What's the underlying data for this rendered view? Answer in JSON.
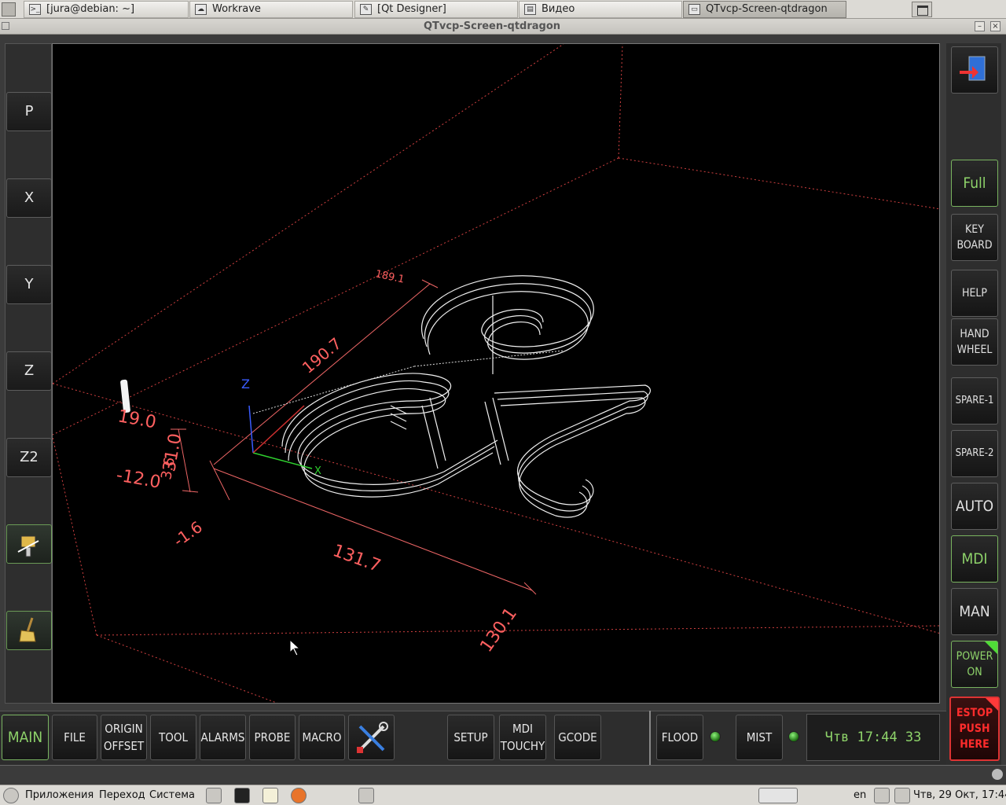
{
  "taskbar": {
    "tasks": [
      {
        "label": "[jura@debian: ~]"
      },
      {
        "label": "Workrave"
      },
      {
        "label": "[Qt Designer]"
      },
      {
        "label": "Видео"
      },
      {
        "label": "QTvcp-Screen-qtdragon"
      }
    ]
  },
  "window": {
    "title": "QTvcp-Screen-qtdragon"
  },
  "left_buttons": {
    "p": "P",
    "x": "X",
    "y": "Y",
    "z": "Z",
    "z2": "Z2"
  },
  "right_buttons": {
    "full": "Full",
    "keyboard": "KEY\nBOARD",
    "help": "HELP",
    "handwheel": "HAND\nWHEEL",
    "spare1": "SPARE-1",
    "spare2": "SPARE-2",
    "auto": "AUTO",
    "mdi": "MDI",
    "man": "MAN",
    "power": "POWER\nON",
    "estop": "ESTOP\nPUSH\nHERE"
  },
  "bottom_tabs": {
    "main": "MAIN",
    "file": "FILE",
    "origin_offset": "ORIGIN\nOFFSET",
    "tool": "TOOL",
    "alarms": "ALARMS",
    "probe": "PROBE",
    "macro": "MACRO",
    "setup": "SETUP",
    "mdi_touchy": "MDI\nTOUCHY",
    "gcode": "GCODE",
    "flood": "FLOOD",
    "mist": "MIST"
  },
  "clock": "Чтв  17:44 33",
  "dimensions": {
    "d1": "189.1",
    "d2": "190.7",
    "d3": "19.0",
    "d4": "31.0",
    "d5": "3.6",
    "d6": "-12.0",
    "d7": "-1.6",
    "d8": "131.7",
    "d9": "130.1",
    "axis_x": "X",
    "axis_z": "Z"
  },
  "colors": {
    "accent_green": "#8ed36a",
    "estop_red": "#ff2c2c",
    "extents_red": "#ff5555"
  },
  "panel": {
    "apps": "Приложения",
    "places": "Переход",
    "system": "Система",
    "lang": "en",
    "datetime": "Чтв, 29 Окт, 17:44"
  }
}
